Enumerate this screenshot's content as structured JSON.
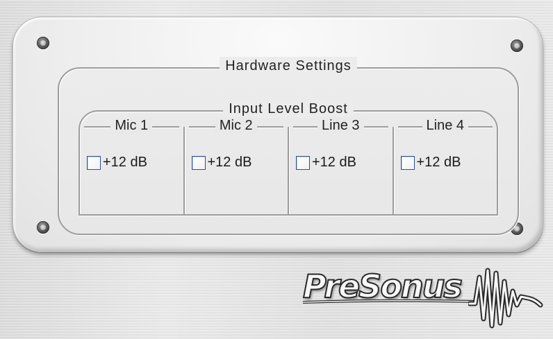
{
  "panel": {
    "title": "Hardware Settings",
    "group_title": "Input Level Boost",
    "channels": [
      {
        "name": "Mic 1",
        "boost_label": "+12 dB",
        "checked": false
      },
      {
        "name": "Mic 2",
        "boost_label": "+12 dB",
        "checked": false
      },
      {
        "name": "Line 3",
        "boost_label": "+12 dB",
        "checked": false
      },
      {
        "name": "Line 4",
        "boost_label": "+12 dB",
        "checked": false
      }
    ]
  },
  "brand": {
    "logo_text": "PreSonus",
    "logo_icon": "waveform-icon"
  },
  "colors": {
    "checkbox_border": "#2c4f9e",
    "etch": "#9c9c9c",
    "plate": "#ececec"
  }
}
